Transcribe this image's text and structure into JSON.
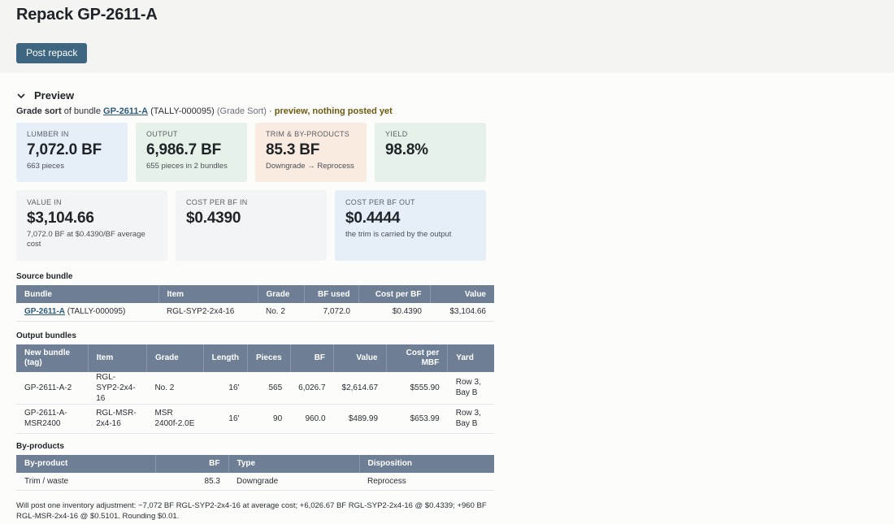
{
  "header": {
    "title": "Repack GP-2611-A",
    "post_button": "Post repack"
  },
  "preview": {
    "heading": "Preview",
    "sub": {
      "kind": "Grade sort",
      "of_bundle": " of bundle ",
      "bundle_link": "GP-2611-A",
      "tally": " (TALLY-000095) ",
      "mode": "(Grade Sort)",
      "sep": " · ",
      "status": "preview, nothing posted yet"
    }
  },
  "metrics_row1": [
    {
      "label": "LUMBER IN",
      "value": "7,072.0 BF",
      "sub": "663 pieces"
    },
    {
      "label": "OUTPUT",
      "value": "6,986.7 BF",
      "sub": "655 pieces in 2 bundles"
    },
    {
      "label": "TRIM & BY-PRODUCTS",
      "value": "85.3 BF",
      "sub": "Downgrade → Reprocess"
    },
    {
      "label": "YIELD",
      "value": "98.8%",
      "sub": ""
    }
  ],
  "metrics_row2": [
    {
      "label": "VALUE IN",
      "value": "$3,104.66",
      "sub": "7,072.0 BF at $0.4390/BF average cost"
    },
    {
      "label": "COST PER BF IN",
      "value": "$0.4390",
      "sub": ""
    },
    {
      "label": "COST PER BF OUT",
      "value": "$0.4444",
      "sub": "the trim is carried by the output"
    }
  ],
  "source": {
    "title": "Source bundle",
    "headers": [
      "Bundle",
      "Item",
      "Grade",
      "BF used",
      "Cost per BF",
      "Value"
    ],
    "row": {
      "bundle_link": "GP-2611-A",
      "tally": " (TALLY-000095)",
      "item": "RGL-SYP2-2x4-16",
      "grade": "No. 2",
      "bf": "7,072.0",
      "cost": "$0.4390",
      "value": "$3,104.66"
    }
  },
  "outputs": {
    "title": "Output bundles",
    "headers": [
      "New bundle (tag)",
      "Item",
      "Grade",
      "Length",
      "Pieces",
      "BF",
      "Value",
      "Cost per MBF",
      "Yard"
    ],
    "rows": [
      {
        "tag": "GP-2611-A-2",
        "item": "RGL-SYP2-2x4-16",
        "grade": "No. 2",
        "length": "16'",
        "pieces": "565",
        "bf": "6,026.7",
        "value": "$2,614.67",
        "cost": "$555.90",
        "yard": "Row 3, Bay B"
      },
      {
        "tag": "GP-2611-A-MSR2400",
        "item": "RGL-MSR-2x4-16",
        "grade": "MSR 2400f-2.0E",
        "length": "16'",
        "pieces": "90",
        "bf": "960.0",
        "value": "$489.99",
        "cost": "$653.99",
        "yard": "Row 3, Bay B"
      }
    ]
  },
  "byproducts": {
    "title": "By-products",
    "headers": [
      "By-product",
      "BF",
      "Type",
      "Disposition"
    ],
    "row": {
      "name": "Trim / waste",
      "bf": "85.3",
      "type": "Downgrade",
      "disposition": "Reprocess"
    }
  },
  "footnote": "Will post one inventory adjustment: −7,072 BF RGL-SYP2-2x4-16 at average cost; +6,026.67 BF RGL-SYP2-2x4-16 @ $0.4339; +960 BF RGL-MSR-2x4-16 @ $0.5101. Rounding $0.01."
}
